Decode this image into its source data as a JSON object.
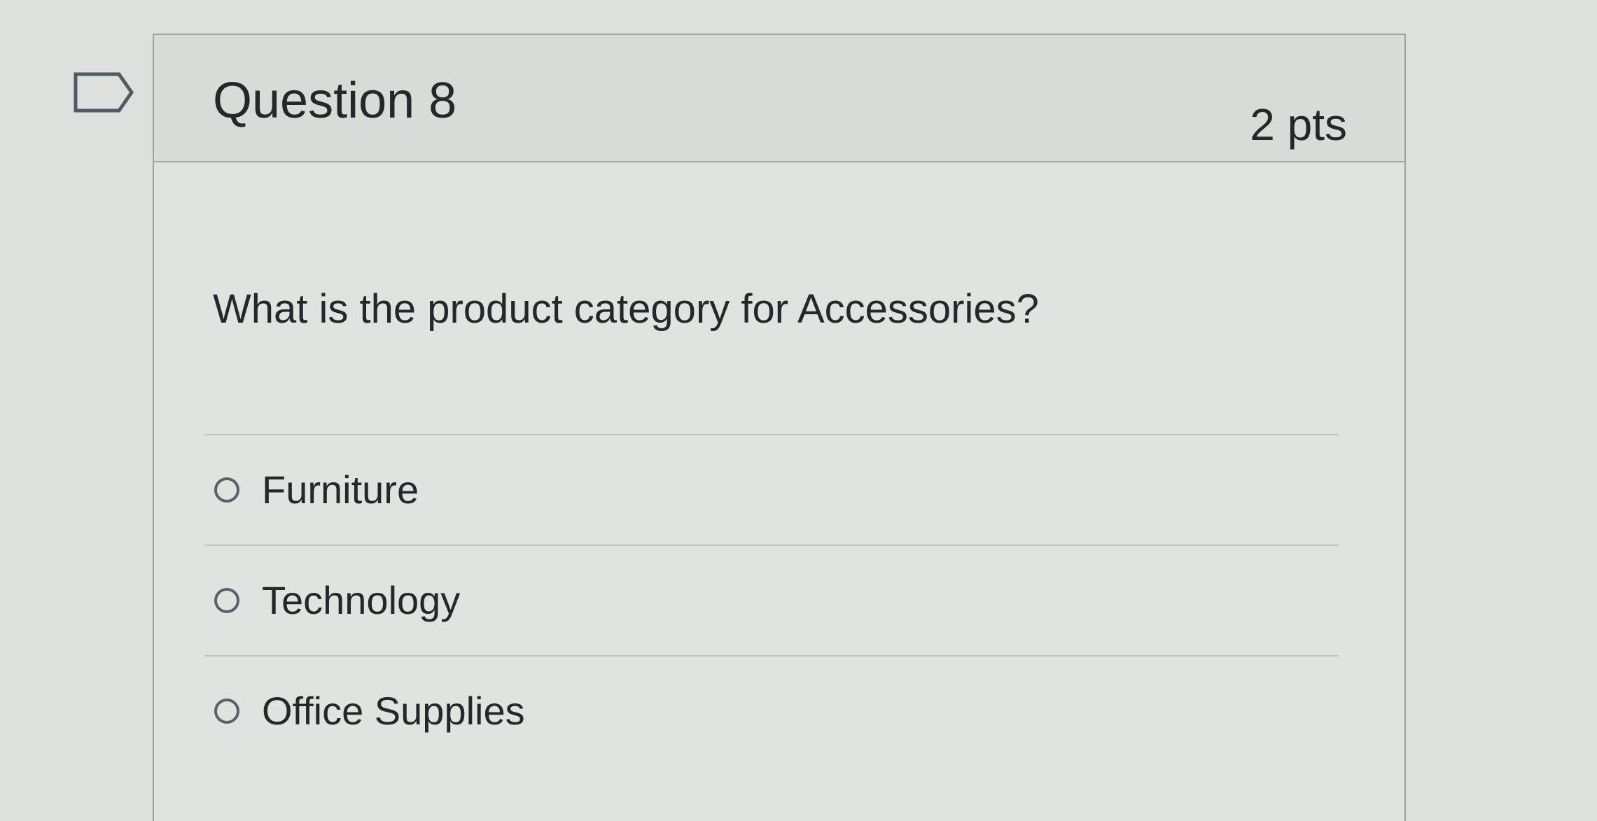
{
  "question": {
    "title": "Question 8",
    "points": "2 pts",
    "text": "What is the product category for Accessories?",
    "options": [
      {
        "label": "Furniture",
        "selected": false
      },
      {
        "label": "Technology",
        "selected": false
      },
      {
        "label": "Office Supplies",
        "selected": false
      }
    ]
  },
  "icons": {
    "flag": "flag-question-icon",
    "radio": "radio-circle-icon"
  }
}
